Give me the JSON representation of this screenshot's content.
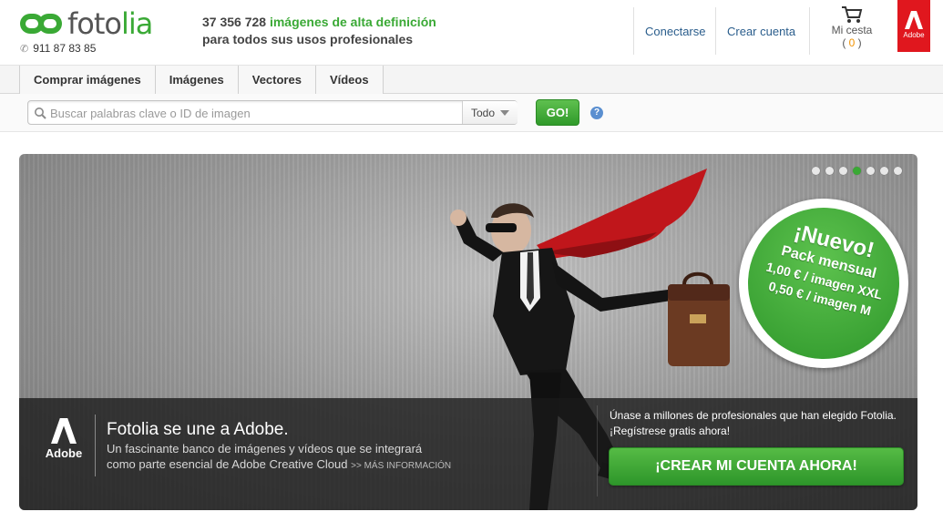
{
  "header": {
    "logo_left": "foto",
    "logo_right": "lia",
    "phone": "911 87 83 85",
    "tagline_count": "37 356 728",
    "tagline_green": "imágenes de alta definición",
    "tagline_line2": "para todos sus usos profesionales",
    "login_label": "Conectarse",
    "signup_label": "Crear cuenta",
    "cart_label": "Mi cesta",
    "cart_count_open": "( ",
    "cart_count_value": "0",
    "cart_count_close": " )",
    "adobe_badge_label": "Adobe"
  },
  "tabs": [
    {
      "label": "Comprar imágenes"
    },
    {
      "label": "Imágenes"
    },
    {
      "label": "Vectores"
    },
    {
      "label": "Vídeos"
    }
  ],
  "search": {
    "placeholder": "Buscar palabras clave o ID de imagen",
    "scope_value": "Todo",
    "go_label": "GO!",
    "help_label": "?"
  },
  "hero": {
    "carousel_total": 7,
    "carousel_active": 4,
    "badge_line1": "¡Nuevo!",
    "badge_line2": "Pack mensual",
    "badge_line3": "1,00 € / imagen XXL",
    "badge_line4": "0,50 € / imagen M",
    "adobe_label": "Adobe",
    "title": "Fotolia se une a Adobe.",
    "subtitle_line1": "Un fascinante banco de imágenes y vídeos que se integrará",
    "subtitle_line2": "como parte esencial de Adobe Creative Cloud",
    "more_info": ">> MÁS INFORMACIÓN",
    "join_text": "Únase a millones de profesionales que han elegido Fotolia. ¡Regístrese gratis ahora!",
    "cta_label": "¡CREAR MI CUENTA AHORA!"
  },
  "colors": {
    "brand_green": "#3aa935",
    "adobe_red": "#e0171e",
    "link_blue": "#2a5d8c",
    "cart_orange": "#f29200"
  },
  "icons": [
    "phone-icon",
    "cart-icon",
    "search-icon",
    "help-icon",
    "adobe-logo-icon",
    "chevron-down-icon"
  ]
}
